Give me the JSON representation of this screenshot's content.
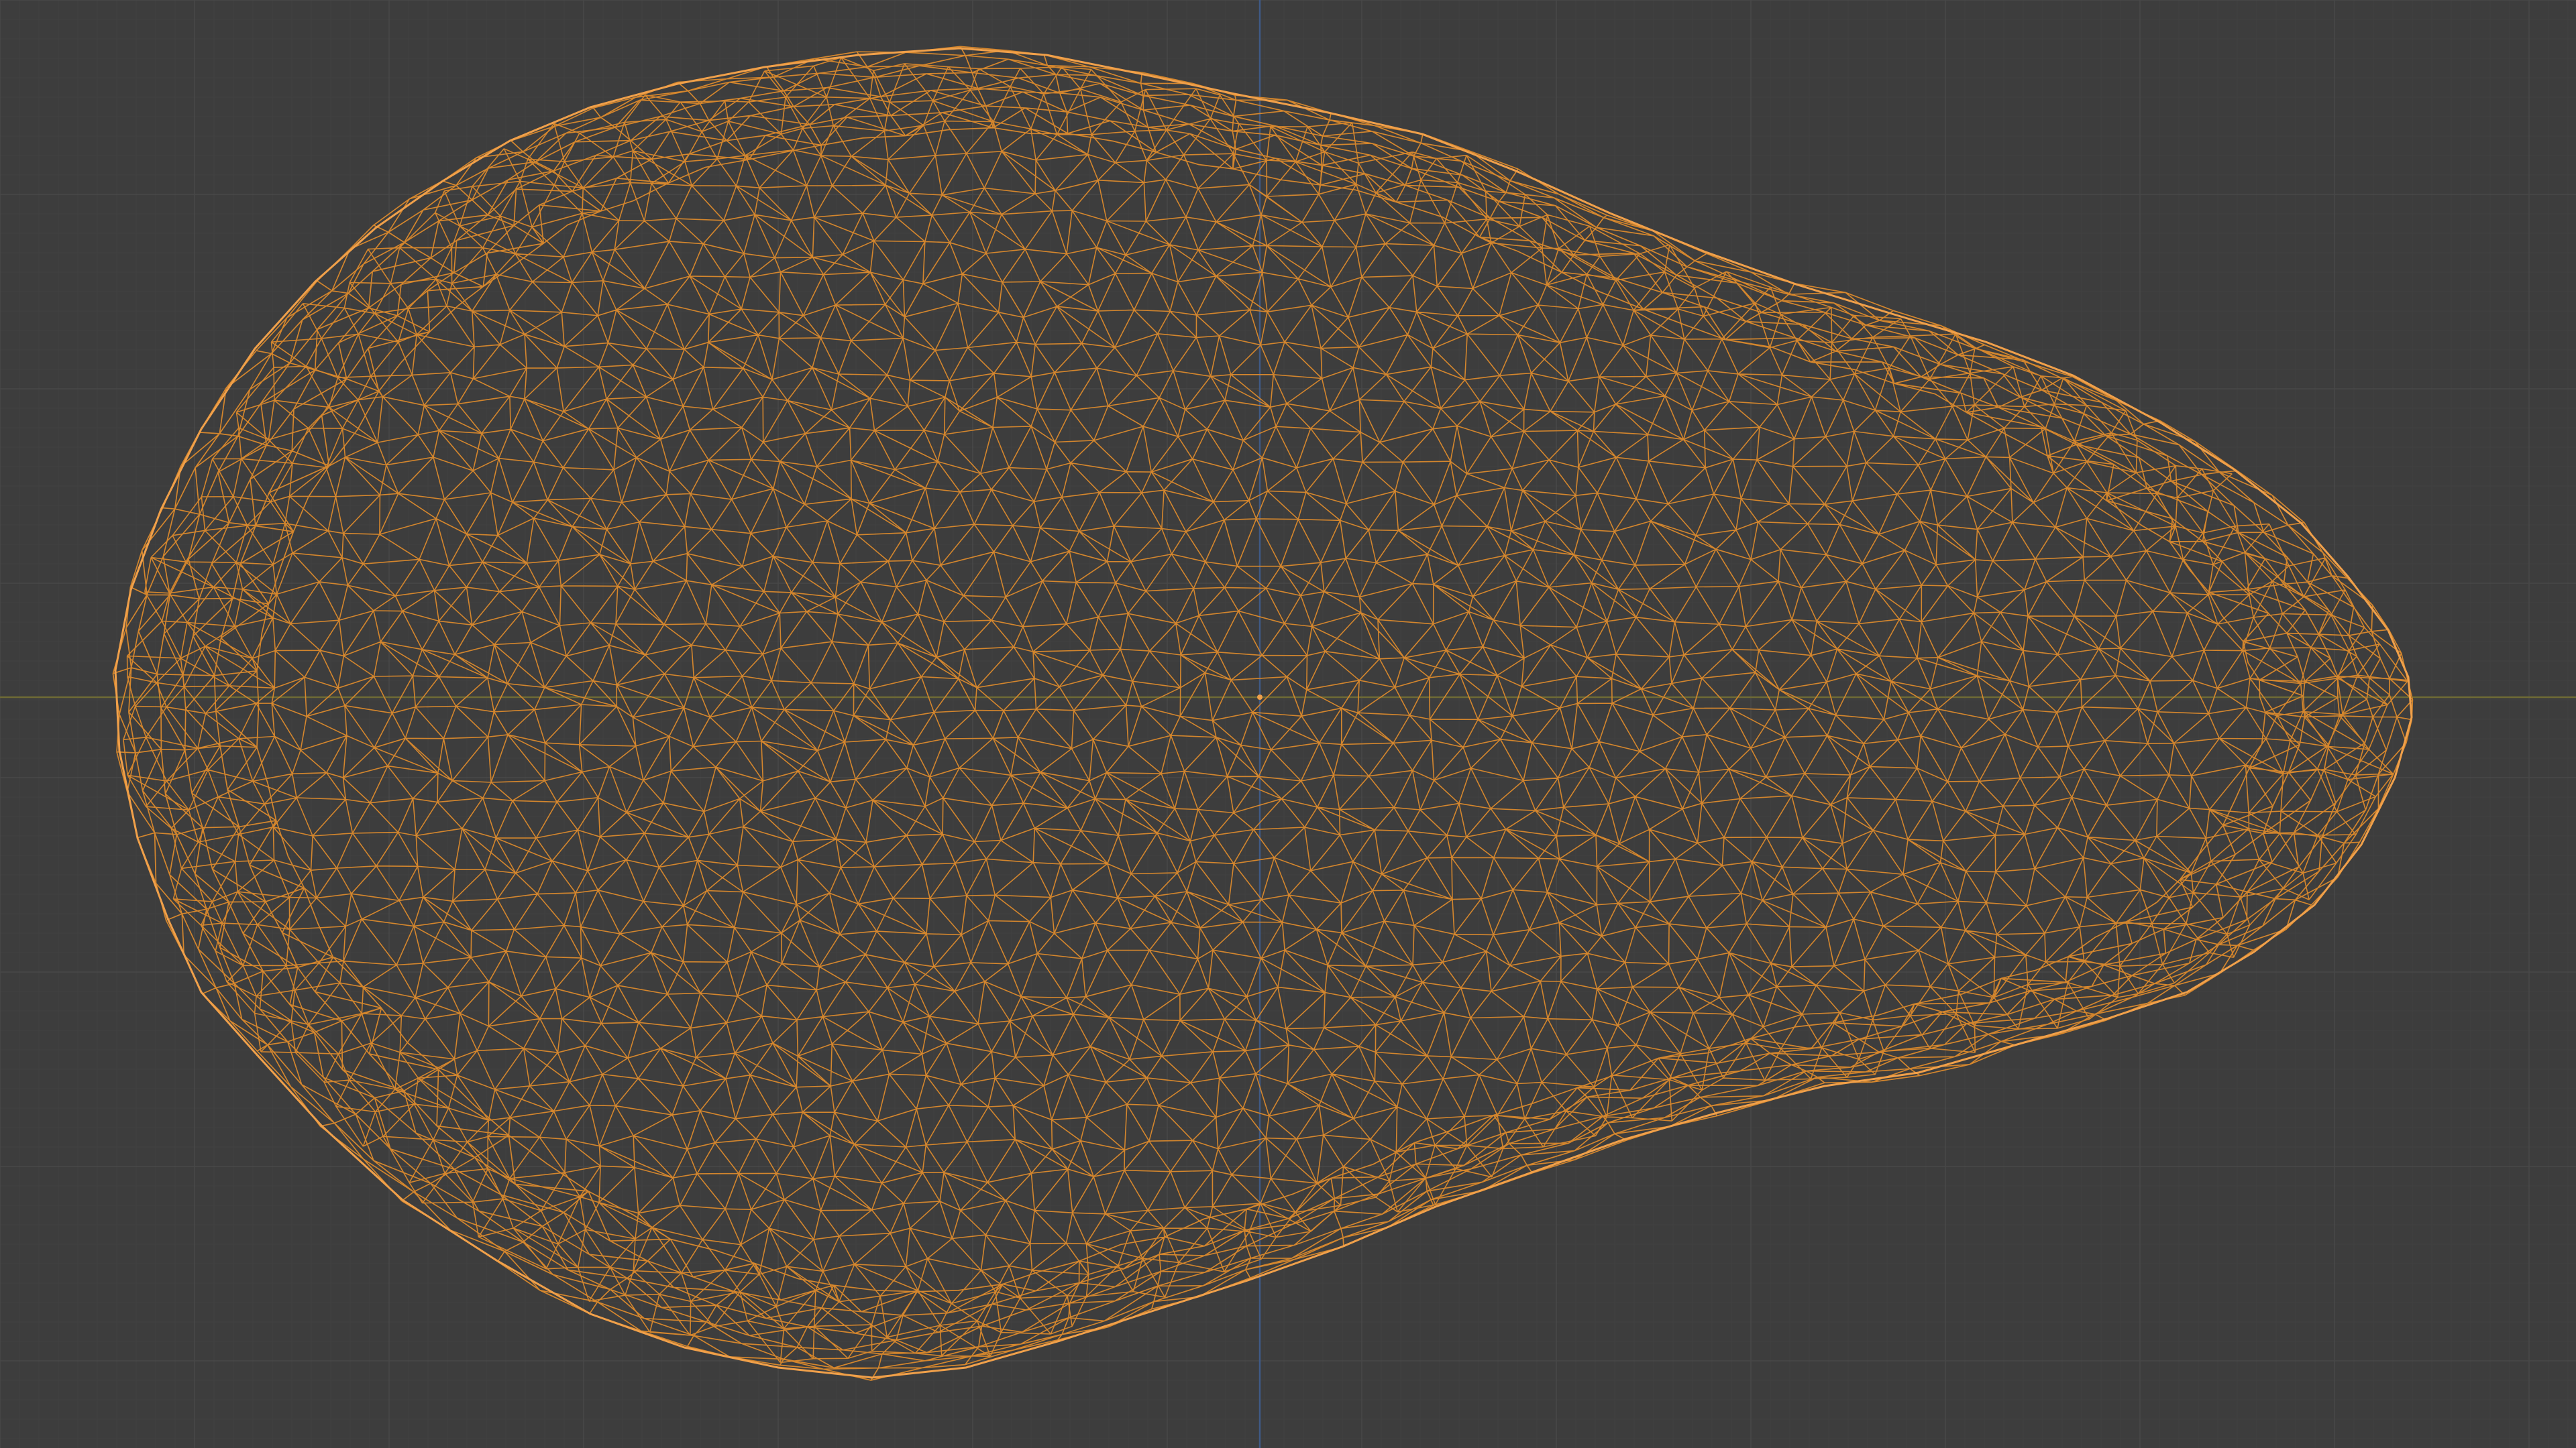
{
  "app": {
    "view": "3D Viewport",
    "shading": "wireframe",
    "mode": "edit",
    "object_type": "mesh"
  },
  "colors": {
    "background": "#3d3d3d",
    "grid_minor": "#414141",
    "grid_major": "#484848",
    "x_axis": "#6e6a35",
    "z_axis": "#3f5a86",
    "wire": "#d4862d",
    "wire_outline": "#f0a04a"
  },
  "icons": {
    "origin": "origin-dot-icon",
    "selection": "selected-mesh-wireframe"
  }
}
